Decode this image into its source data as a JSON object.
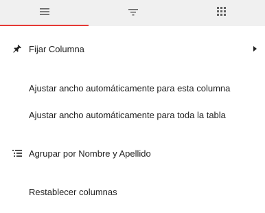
{
  "tabs": [
    {
      "icon": "menu-icon",
      "active": true
    },
    {
      "icon": "filter-icon",
      "active": false
    },
    {
      "icon": "columns-grid-icon",
      "active": false
    }
  ],
  "colors": {
    "accent": "#e53935",
    "tabbar_bg": "#f0f0f0",
    "icon": "#616161"
  },
  "menu": {
    "pin_column": {
      "label": "Fijar Columna",
      "icon": "pin-icon",
      "has_submenu": true
    },
    "autosize_this": {
      "label": "Ajustar ancho automáticamente para esta columna"
    },
    "autosize_all": {
      "label": "Ajustar ancho automáticamente para toda la tabla"
    },
    "group_by": {
      "label": "Agrupar por Nombre y Apellido",
      "icon": "group-list-icon"
    },
    "reset_columns": {
      "label": "Restablecer columnas"
    }
  }
}
